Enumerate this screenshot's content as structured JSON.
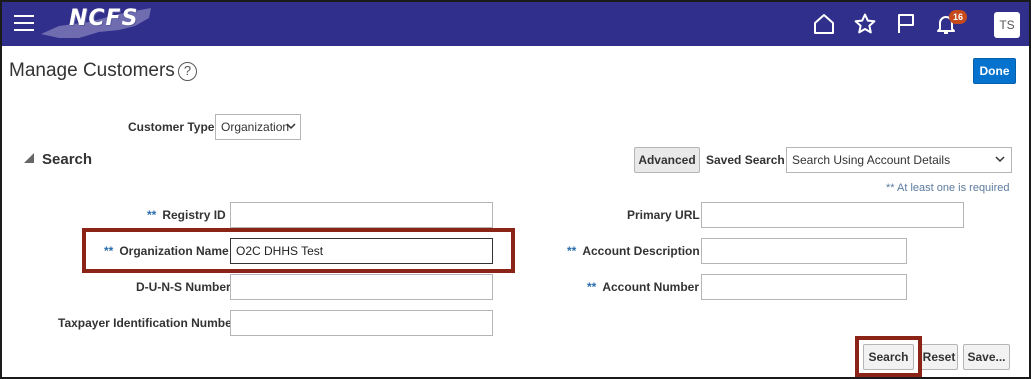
{
  "header": {
    "logo_text": "NCFS",
    "notification_count": "16",
    "user_initials": "TS"
  },
  "page": {
    "title": "Manage Customers",
    "help_glyph": "?",
    "done_label": "Done"
  },
  "customer_type": {
    "label": "Customer Type",
    "value": "Organization"
  },
  "search": {
    "section_title": "Search",
    "advanced_label": "Advanced",
    "saved_search_label": "Saved Search",
    "saved_search_value": "Search Using Account Details",
    "hint": "** At least one is required",
    "required_marker": "**",
    "fields": {
      "registry_id": {
        "label": "Registry ID",
        "value": ""
      },
      "organization_name": {
        "label": "Organization Name",
        "value": "O2C DHHS Test"
      },
      "duns_number": {
        "label": "D-U-N-S Number",
        "value": ""
      },
      "taxpayer_id": {
        "label": "Taxpayer Identification Number",
        "value": ""
      },
      "primary_url": {
        "label": "Primary URL",
        "value": ""
      },
      "account_description": {
        "label": "Account Description",
        "value": ""
      },
      "account_number": {
        "label": "Account Number",
        "value": ""
      }
    },
    "buttons": {
      "search": "Search",
      "reset": "Reset",
      "save": "Save..."
    }
  },
  "colors": {
    "header_bg": "#312f8c",
    "primary_button": "#0572ce",
    "highlight_border": "#8b2416",
    "badge": "#c54a1c"
  }
}
